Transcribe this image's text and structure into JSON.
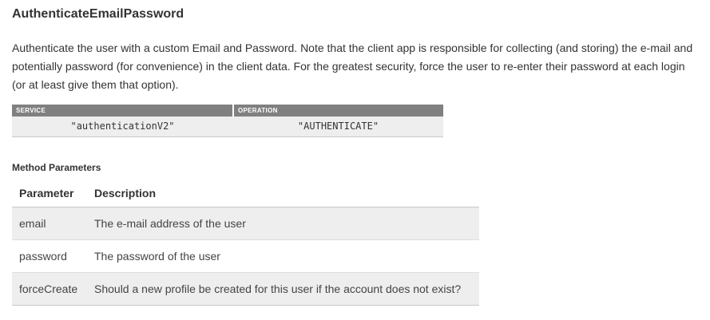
{
  "title": "AuthenticateEmailPassword",
  "description": "Authenticate the user with a custom Email and Password. Note that the client app is responsible for collecting (and storing) the e-mail and potentially password (for convenience) in the client data. For the greatest security, force the user to re-enter their password at each login (or at least give them that option).",
  "service_table": {
    "headers": {
      "service": "SERVICE",
      "operation": "OPERATION"
    },
    "row": {
      "service": "\"authenticationV2\"",
      "operation": "\"AUTHENTICATE\""
    }
  },
  "method_parameters": {
    "heading": "Method Parameters",
    "columns": {
      "parameter": "Parameter",
      "description": "Description"
    },
    "rows": [
      {
        "parameter": "email",
        "description": "The e-mail address of the user"
      },
      {
        "parameter": "password",
        "description": "The password of the user"
      },
      {
        "parameter": "forceCreate",
        "description": "Should a new profile be created for this user if the account does not exist?"
      }
    ]
  }
}
